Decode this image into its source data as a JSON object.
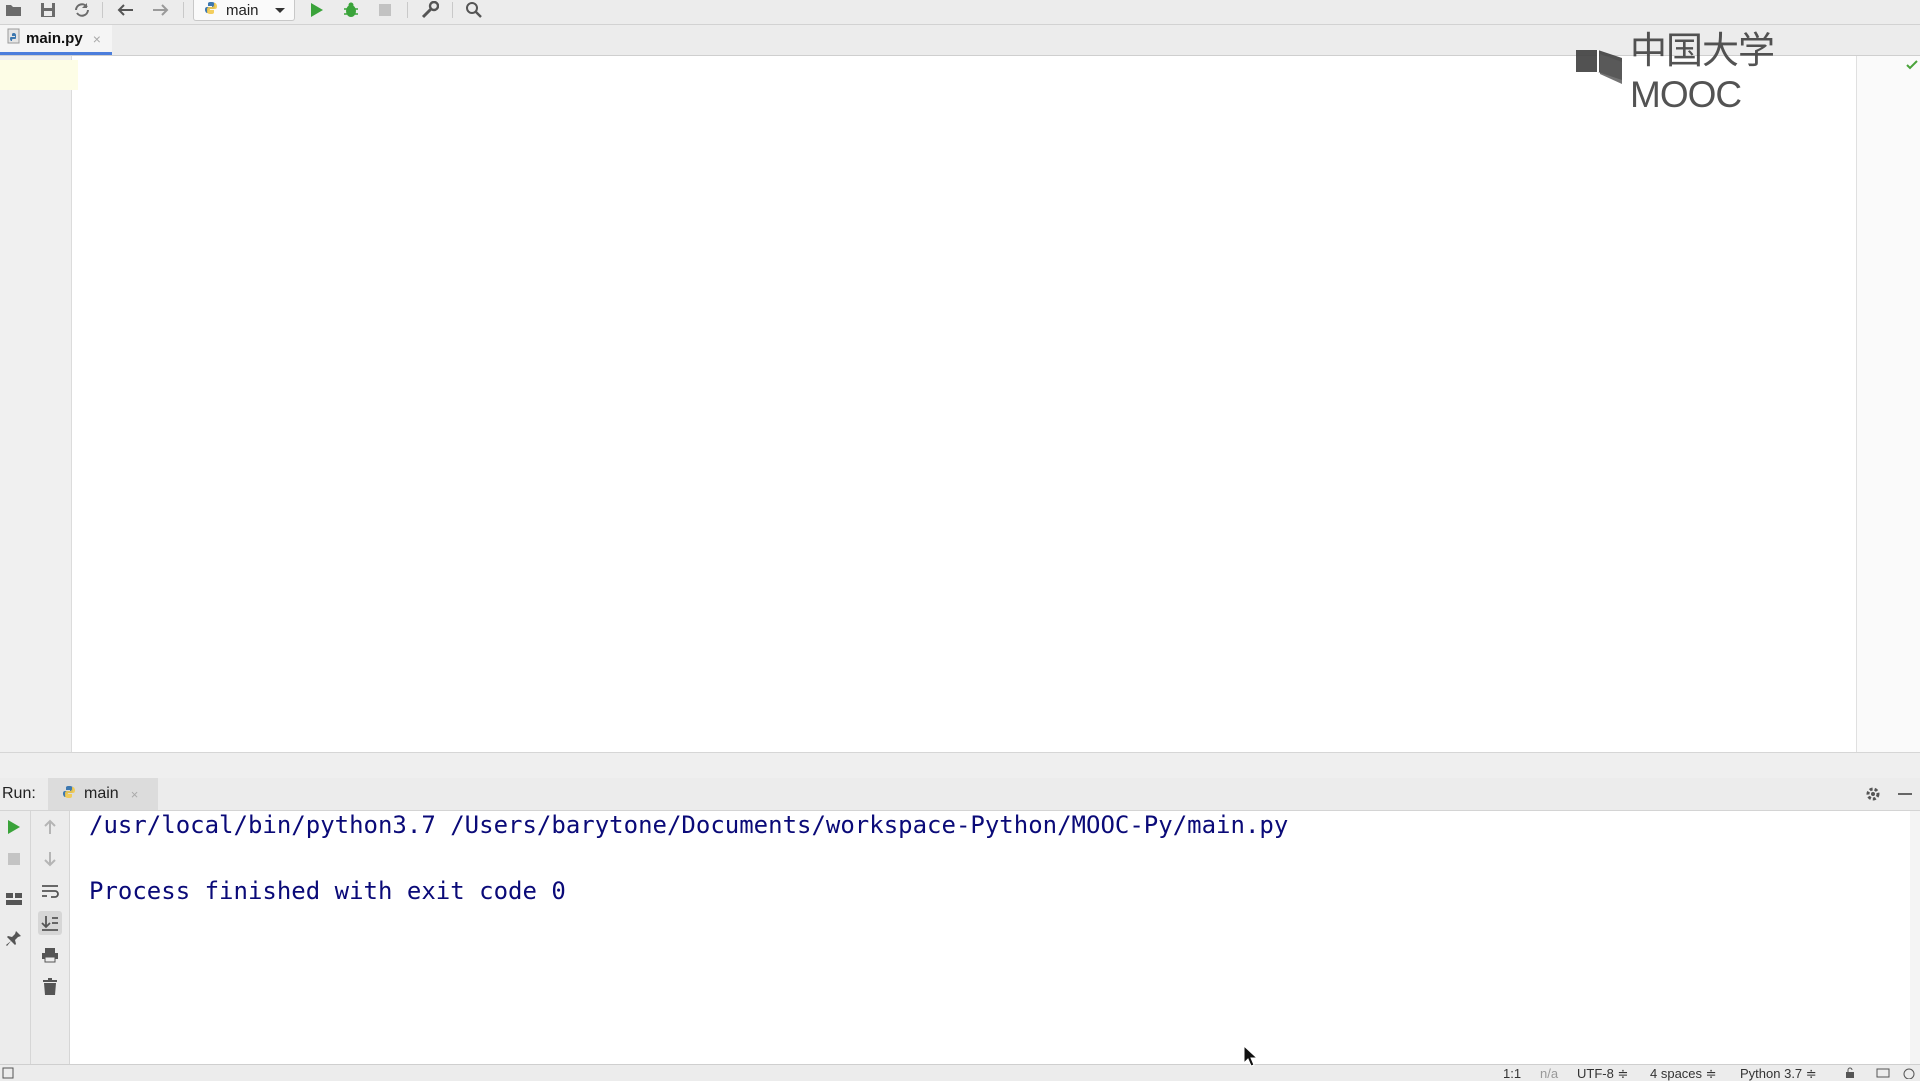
{
  "toolbar": {
    "run_config": "main"
  },
  "editor": {
    "tab_label": "main.py",
    "tab_close": "×"
  },
  "watermark": {
    "text": "中国大学MOOC"
  },
  "run_panel": {
    "label": "Run:",
    "tab_label": "main",
    "tab_close": "×"
  },
  "console": {
    "lines": [
      "/usr/local/bin/python3.7 /Users/barytone/Documents/workspace-Python/MOOC-Py/main.py",
      "",
      "Process finished with exit code 0"
    ]
  },
  "status_bar": {
    "position": "1:1",
    "na": "n/a",
    "encoding": "UTF-8 ≑",
    "indent": "4 spaces ≑",
    "interpreter": "Python 3.7 ≑"
  },
  "colors": {
    "console_text": "#0a0a78",
    "run_green": "#3aa33a",
    "tab_underline": "#4c7edc"
  }
}
